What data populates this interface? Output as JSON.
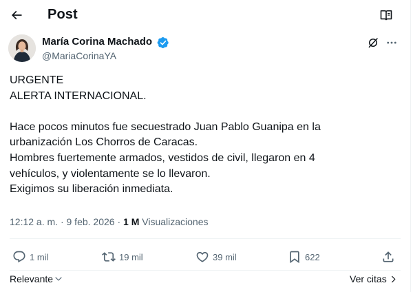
{
  "header": {
    "title": "Post",
    "back_icon": "arrow-left-icon",
    "reader_icon": "open-book-icon"
  },
  "author": {
    "name": "María Corina Machado",
    "handle": "@MariaCorinaYA",
    "verified_icon": "verified-badge-icon",
    "verified_color": "#1d9bf0"
  },
  "tweet": {
    "lines": [
      "URGENTE",
      "ALERTA INTERNACIONAL.",
      "",
      "Hace pocos minutos fue secuestrado Juan Pablo Guanipa en la",
      "urbanización Los Chorros de Caracas.",
      "Hombres fuertemente armados, vestidos de civil, llegaron en 4",
      "vehículos, y violentamente se lo llevaron.",
      "Exigimos su liberación inmediata."
    ]
  },
  "meta": {
    "time": "12:12 a. m.",
    "separator": "·",
    "date": "9 feb. 2026",
    "views_count": "1 M",
    "views_label": "Visualizaciones"
  },
  "actions": {
    "replies": "1 mil",
    "reposts": "19 mil",
    "likes": "39 mil",
    "bookmarks": "622"
  },
  "footer": {
    "sort_label": "Relevante",
    "quotes_label": "Ver citas"
  },
  "colors": {
    "text_primary": "#0f1419",
    "text_secondary": "#536471",
    "divider": "#eff3f4",
    "accent": "#1d9bf0"
  }
}
